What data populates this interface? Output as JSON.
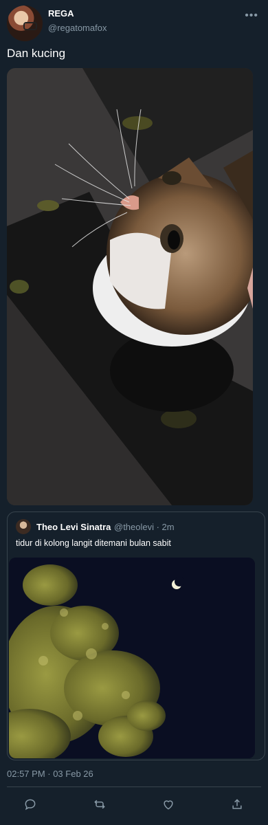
{
  "tweet": {
    "author_name": "REGA",
    "author_handle": "@regatomafox",
    "more_icon": "ellipsis-icon",
    "text": "Dan kucing",
    "timestamp": "02:57 PM · 03 Feb 26"
  },
  "quoted_tweet": {
    "author_name": "Theo Levi Sinatra",
    "author_handle": "@theolevi · 2m",
    "text": "tidur di kolong langit ditemani bulan sabit"
  },
  "actions": [
    {
      "icon": "reply-icon"
    },
    {
      "icon": "retweet-icon"
    },
    {
      "icon": "like-icon"
    },
    {
      "icon": "share-icon"
    }
  ],
  "colors": {
    "background": "#15202b",
    "secondary_text": "#8899a6",
    "border": "#38444d"
  }
}
